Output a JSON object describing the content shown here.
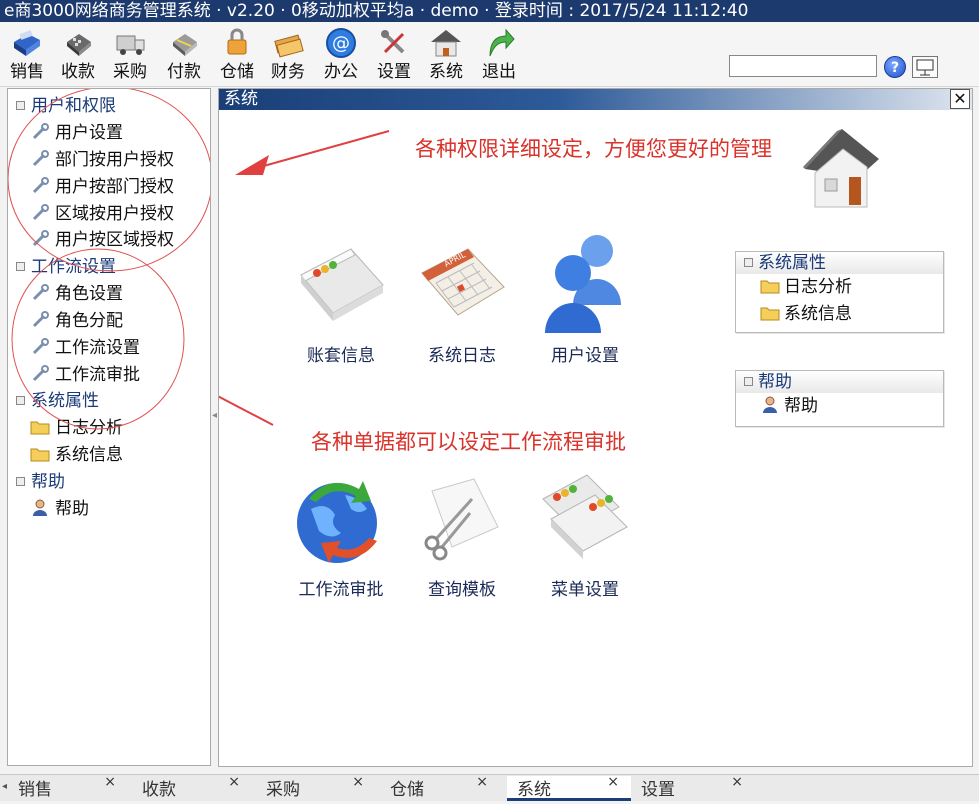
{
  "window": {
    "title": "e商3000网络商务管理系统 · v2.20 · 0移动加权平均a · demo · 登录时间 : 2017/5/24 11:12:40"
  },
  "toolbar": {
    "items": [
      {
        "label": "销售",
        "icon": "sales-icon"
      },
      {
        "label": "收款",
        "icon": "receipt-icon"
      },
      {
        "label": "采购",
        "icon": "purchase-icon"
      },
      {
        "label": "付款",
        "icon": "payment-icon"
      },
      {
        "label": "仓储",
        "icon": "warehouse-icon"
      },
      {
        "label": "财务",
        "icon": "finance-icon"
      },
      {
        "label": "办公",
        "icon": "office-icon"
      },
      {
        "label": "设置",
        "icon": "settings-icon"
      },
      {
        "label": "系统",
        "icon": "system-icon"
      },
      {
        "label": "退出",
        "icon": "exit-icon"
      }
    ],
    "search_value": "",
    "help_label": "?"
  },
  "tree": {
    "groups": [
      {
        "label": "用户和权限",
        "items": [
          "用户设置",
          "部门按用户授权",
          "用户按部门授权",
          "区域按用户授权",
          "用户按区域授权"
        ]
      },
      {
        "label": "工作流设置",
        "items": [
          "角色设置",
          "角色分配",
          "工作流设置",
          "工作流审批"
        ]
      },
      {
        "label": "系统属性",
        "items": [
          "日志分析",
          "系统信息"
        ]
      },
      {
        "label": "帮助",
        "items": [
          "帮助"
        ]
      }
    ]
  },
  "panel": {
    "title": "系统",
    "close_label": "✕",
    "annotations": {
      "permissions": "各种权限详细设定，方便您更好的管理",
      "workflow": "各种单据都可以设定工作流程审批"
    },
    "tiles": [
      {
        "label": "账套信息"
      },
      {
        "label": "系统日志"
      },
      {
        "label": "用户设置"
      },
      {
        "label": "工作流审批"
      },
      {
        "label": "查询模板"
      },
      {
        "label": "菜单设置"
      }
    ],
    "side_boxes": [
      {
        "title": "系统属性",
        "items": [
          "日志分析",
          "系统信息"
        ]
      },
      {
        "title": "帮助",
        "items": [
          "帮助"
        ]
      }
    ]
  },
  "tabs": [
    {
      "label": "销售",
      "active": false
    },
    {
      "label": "收款",
      "active": false
    },
    {
      "label": "采购",
      "active": false
    },
    {
      "label": "仓储",
      "active": false
    },
    {
      "label": "系统",
      "active": true
    },
    {
      "label": "设置",
      "active": false
    }
  ],
  "tab_close": "×",
  "colors": {
    "titlebar": "#1d3a6e",
    "annotation": "#d9332b",
    "link": "#1a3a78"
  }
}
